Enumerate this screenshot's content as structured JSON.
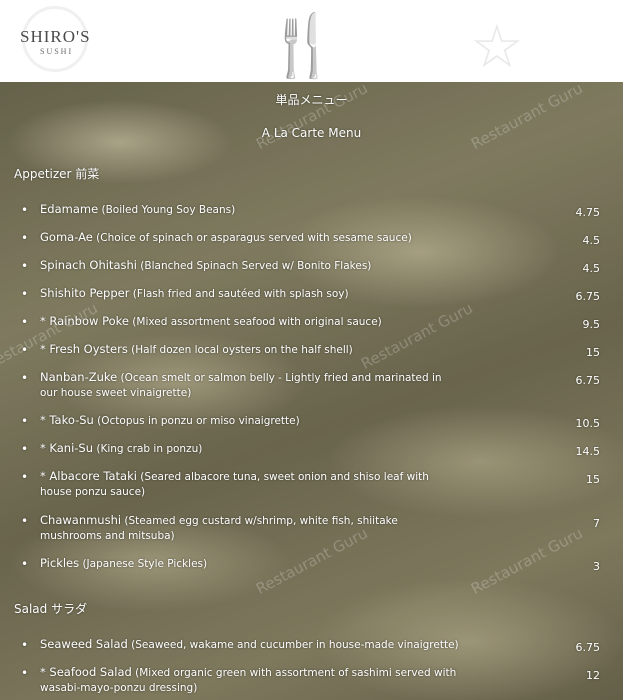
{
  "header": {
    "logo_name": "SHIRO'S",
    "logo_sub": "SUSHI"
  },
  "menu": {
    "title_jp": "単品メニュー",
    "title_en": "A La Carte Menu",
    "watermark": "Restaurant Guru",
    "sections": [
      {
        "heading": "Appetizer 前菜"
      },
      {
        "heading": "Salad サラダ"
      }
    ],
    "items": [
      {
        "name": "Edamame",
        "desc": " (Boiled Young Soy Beans)",
        "price": "4.75"
      },
      {
        "name": "Goma-Ae",
        "desc": " (Choice of spinach or asparagus served with sesame sauce)",
        "price": "4.5"
      },
      {
        "name": "Spinach Ohitashi",
        "desc": " (Blanched Spinach Served w/ Bonito Flakes)",
        "price": "4.5"
      },
      {
        "name": "Shishito Pepper",
        "desc": " (Flash fried and sautéed with splash soy)",
        "price": "6.75"
      },
      {
        "name": "* Rainbow Poke",
        "desc": " (Mixed assortment seafood with original sauce)",
        "price": "9.5"
      },
      {
        "name": "* Fresh Oysters",
        "desc": " (Half dozen local oysters on the half shell)",
        "price": "15"
      },
      {
        "name": "Nanban-Zuke",
        "desc": " (Ocean smelt or salmon belly - Lightly fried and marinated in our house sweet vinaigrette)",
        "price": "6.75"
      },
      {
        "name": "* Tako-Su",
        "desc": " (Octopus in ponzu or miso vinaigrette)",
        "price": "10.5"
      },
      {
        "name": "* Kani-Su",
        "desc": " (King crab in ponzu)",
        "price": "14.5"
      },
      {
        "name": "* Albacore Tataki",
        "desc": " (Seared albacore tuna, sweet onion and shiso leaf with house ponzu sauce)",
        "price": "15"
      },
      {
        "name": "Chawanmushi",
        "desc": " (Steamed egg custard w/shrimp, white fish, shiitake mushrooms and mitsuba)",
        "price": "7"
      },
      {
        "name": "Pickles",
        "desc": " (Japanese Style Pickles)",
        "price": "3"
      },
      {
        "name": "Seaweed Salad",
        "desc": " (Seaweed, wakame and cucumber in house-made vinaigrette)",
        "price": "6.75"
      },
      {
        "name": "* Seafood Salad",
        "desc": " (Mixed organic green with assortment of sashimi served with wasabi-mayo-ponzu dressing)",
        "price": "12"
      }
    ]
  }
}
